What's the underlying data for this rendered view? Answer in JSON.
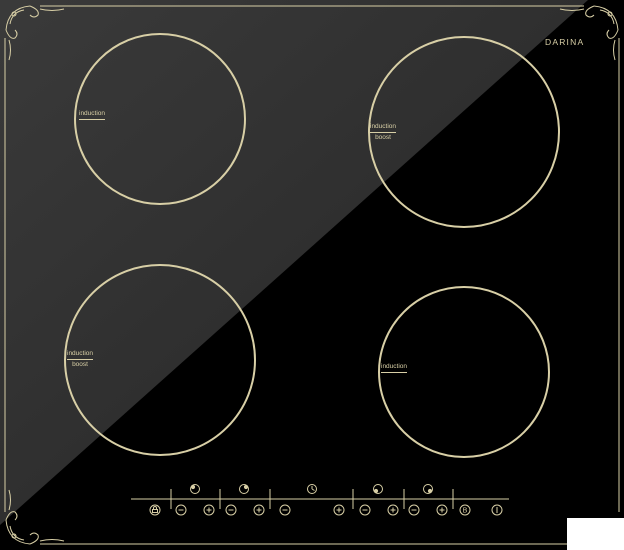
{
  "brand": "DARINA",
  "zones": [
    {
      "id": "top-left",
      "label": "induction",
      "sub": ""
    },
    {
      "id": "top-right",
      "label": "induction",
      "sub": "boost"
    },
    {
      "id": "bottom-left",
      "label": "induction",
      "sub": "boost"
    },
    {
      "id": "bottom-right",
      "label": "induction",
      "sub": ""
    }
  ],
  "controls": {
    "zone_indicators": [
      "zone-indicator-1",
      "zone-indicator-2",
      "zone-indicator-3",
      "zone-indicator-4"
    ],
    "buttons": [
      "lock",
      "minus",
      "plus",
      "minus",
      "plus",
      "timer-minus",
      "timer-plus",
      "minus",
      "plus",
      "minus",
      "plus",
      "boost",
      "power"
    ],
    "boost_letter": "B"
  },
  "colors": {
    "glass": "#000000",
    "reflection": "#2a2a2a",
    "trim": "#d8cfa6"
  }
}
